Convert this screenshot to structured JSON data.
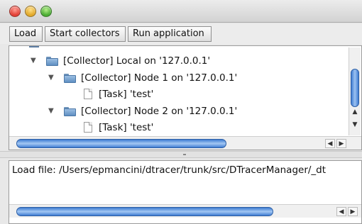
{
  "window": {
    "controls": [
      "close",
      "minimize",
      "zoom"
    ]
  },
  "toolbar": {
    "load_label": "Load",
    "start_collectors_label": "Start collectors",
    "run_application_label": "Run application"
  },
  "tree": {
    "nodes": [
      {
        "label": "[Collector] Local on '127.0.0.1'",
        "icon": "folder-icon",
        "expanded": true
      },
      {
        "label": "[Collector] Node 1 on '127.0.0.1'",
        "icon": "folder-icon",
        "expanded": true
      },
      {
        "label": "[Task]  'test'",
        "icon": "document-icon"
      },
      {
        "label": "[Collector] Node 2 on '127.0.0.1'",
        "icon": "folder-icon",
        "expanded": true
      },
      {
        "label": "[Task]  'test'",
        "icon": "document-icon"
      }
    ]
  },
  "log": {
    "line": "Load file: /Users/epmancini/dtracer/trunk/src/DTracerManager/_dt"
  },
  "colors": {
    "scroll_thumb": "#3f7cd2",
    "folder": "#6d93bb",
    "window_bg": "#e8e8e8"
  }
}
